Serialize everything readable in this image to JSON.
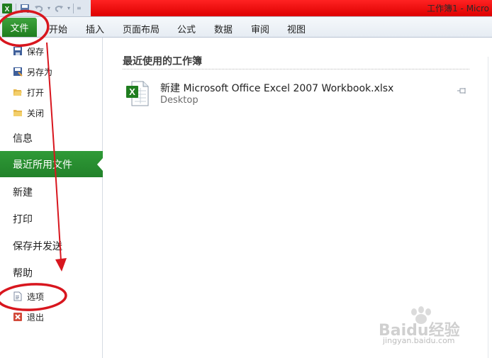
{
  "window": {
    "title": "工作簿1 - Micro",
    "brand_color": "#1f7d1f",
    "titlebar_accent": "#e00000"
  },
  "ribbon": {
    "file_tab": "文件",
    "tabs": [
      "开始",
      "插入",
      "页面布局",
      "公式",
      "数据",
      "审阅",
      "视图"
    ]
  },
  "nav": {
    "save": "保存",
    "save_as": "另存为",
    "open": "打开",
    "close": "关闭",
    "info": "信息",
    "recent": "最近所用文件",
    "new": "新建",
    "print": "打印",
    "save_send": "保存并发送",
    "help": "帮助",
    "options": "选项",
    "exit": "退出"
  },
  "recent": {
    "heading": "最近使用的工作簿",
    "files": [
      {
        "name": "新建 Microsoft Office Excel 2007 Workbook.xlsx",
        "location": "Desktop",
        "icon": "excel-file-icon"
      }
    ]
  },
  "watermark": {
    "brand": "Baidu经验",
    "url": "jingyan.baidu.com"
  }
}
